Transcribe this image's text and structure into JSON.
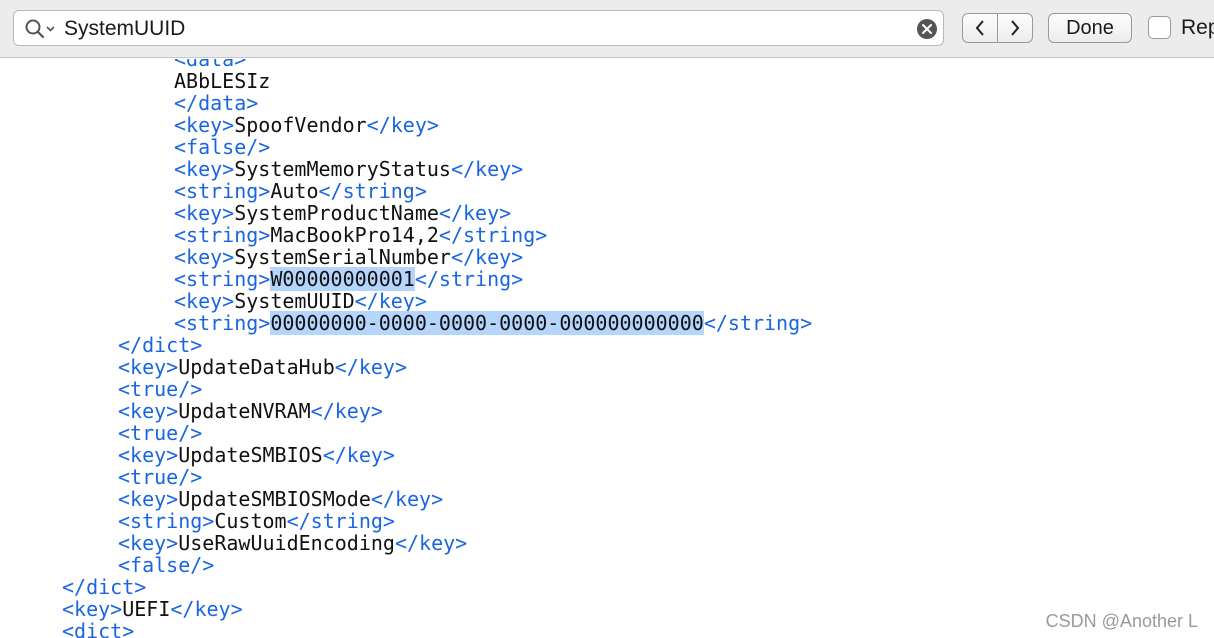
{
  "find_bar": {
    "search_value": "SystemUUID",
    "done_label": "Done",
    "checkbox_label": "Rep",
    "checkbox_checked": false,
    "icons": {
      "search": "search-icon",
      "dropdown": "chevron-down-icon",
      "clear": "clear-icon",
      "previous": "chevron-left-icon",
      "next": "chevron-right-icon"
    }
  },
  "editor": {
    "lines": [
      {
        "indent": 3,
        "parts": [
          {
            "t": "<data>",
            "type": "tag"
          }
        ]
      },
      {
        "indent": 3,
        "parts": [
          {
            "t": "ABbLESIz",
            "type": "val"
          }
        ]
      },
      {
        "indent": 3,
        "parts": [
          {
            "t": "</data>",
            "type": "tag"
          }
        ]
      },
      {
        "indent": 3,
        "parts": [
          {
            "t": "<key>",
            "type": "tag"
          },
          {
            "t": "SpoofVendor",
            "type": "val"
          },
          {
            "t": "</key>",
            "type": "tag"
          }
        ]
      },
      {
        "indent": 3,
        "parts": [
          {
            "t": "<false/>",
            "type": "tag"
          }
        ]
      },
      {
        "indent": 3,
        "parts": [
          {
            "t": "<key>",
            "type": "tag"
          },
          {
            "t": "SystemMemoryStatus",
            "type": "val"
          },
          {
            "t": "</key>",
            "type": "tag"
          }
        ]
      },
      {
        "indent": 3,
        "parts": [
          {
            "t": "<string>",
            "type": "tag"
          },
          {
            "t": "Auto",
            "type": "val"
          },
          {
            "t": "</string>",
            "type": "tag"
          }
        ]
      },
      {
        "indent": 3,
        "parts": [
          {
            "t": "<key>",
            "type": "tag"
          },
          {
            "t": "SystemProductName",
            "type": "val"
          },
          {
            "t": "</key>",
            "type": "tag"
          }
        ]
      },
      {
        "indent": 3,
        "parts": [
          {
            "t": "<string>",
            "type": "tag"
          },
          {
            "t": "MacBookPro14,2",
            "type": "val"
          },
          {
            "t": "</string>",
            "type": "tag"
          }
        ]
      },
      {
        "indent": 3,
        "parts": [
          {
            "t": "<key>",
            "type": "tag"
          },
          {
            "t": "SystemSerialNumber",
            "type": "val"
          },
          {
            "t": "</key>",
            "type": "tag"
          }
        ]
      },
      {
        "indent": 3,
        "parts": [
          {
            "t": "<string>",
            "type": "tag"
          },
          {
            "t": "W00000000001",
            "type": "val",
            "highlight": true
          },
          {
            "t": "</string>",
            "type": "tag"
          }
        ]
      },
      {
        "indent": 3,
        "parts": [
          {
            "t": "<key>",
            "type": "tag"
          },
          {
            "t": "SystemUUID",
            "type": "val"
          },
          {
            "t": "</key>",
            "type": "tag"
          }
        ]
      },
      {
        "indent": 3,
        "parts": [
          {
            "t": "<string>",
            "type": "tag"
          },
          {
            "t": "00000000-0000-0000-0000-000000000000",
            "type": "val",
            "highlight": true
          },
          {
            "t": "</string>",
            "type": "tag"
          }
        ]
      },
      {
        "indent": 2,
        "parts": [
          {
            "t": "</dict>",
            "type": "tag"
          }
        ]
      },
      {
        "indent": 2,
        "parts": [
          {
            "t": "<key>",
            "type": "tag"
          },
          {
            "t": "UpdateDataHub",
            "type": "val"
          },
          {
            "t": "</key>",
            "type": "tag"
          }
        ]
      },
      {
        "indent": 2,
        "parts": [
          {
            "t": "<true/>",
            "type": "tag"
          }
        ]
      },
      {
        "indent": 2,
        "parts": [
          {
            "t": "<key>",
            "type": "tag"
          },
          {
            "t": "UpdateNVRAM",
            "type": "val"
          },
          {
            "t": "</key>",
            "type": "tag"
          }
        ]
      },
      {
        "indent": 2,
        "parts": [
          {
            "t": "<true/>",
            "type": "tag"
          }
        ]
      },
      {
        "indent": 2,
        "parts": [
          {
            "t": "<key>",
            "type": "tag"
          },
          {
            "t": "UpdateSMBIOS",
            "type": "val"
          },
          {
            "t": "</key>",
            "type": "tag"
          }
        ]
      },
      {
        "indent": 2,
        "parts": [
          {
            "t": "<true/>",
            "type": "tag"
          }
        ]
      },
      {
        "indent": 2,
        "parts": [
          {
            "t": "<key>",
            "type": "tag"
          },
          {
            "t": "UpdateSMBIOSMode",
            "type": "val"
          },
          {
            "t": "</key>",
            "type": "tag"
          }
        ]
      },
      {
        "indent": 2,
        "parts": [
          {
            "t": "<string>",
            "type": "tag"
          },
          {
            "t": "Custom",
            "type": "val"
          },
          {
            "t": "</string>",
            "type": "tag"
          }
        ]
      },
      {
        "indent": 2,
        "parts": [
          {
            "t": "<key>",
            "type": "tag"
          },
          {
            "t": "UseRawUuidEncoding",
            "type": "val"
          },
          {
            "t": "</key>",
            "type": "tag"
          }
        ]
      },
      {
        "indent": 2,
        "parts": [
          {
            "t": "<false/>",
            "type": "tag"
          }
        ]
      },
      {
        "indent": 1,
        "parts": [
          {
            "t": "</dict>",
            "type": "tag"
          }
        ]
      },
      {
        "indent": 1,
        "parts": [
          {
            "t": "<key>",
            "type": "tag"
          },
          {
            "t": "UEFI",
            "type": "val"
          },
          {
            "t": "</key>",
            "type": "tag"
          }
        ]
      },
      {
        "indent": 1,
        "parts": [
          {
            "t": "<dict>",
            "type": "tag"
          }
        ]
      }
    ]
  },
  "watermark": "CSDN @Another L",
  "colors": {
    "tag": "#1a66e0",
    "value": "#111111",
    "highlight": "#b5d5fd",
    "toolbar_bg": "#ececec"
  }
}
